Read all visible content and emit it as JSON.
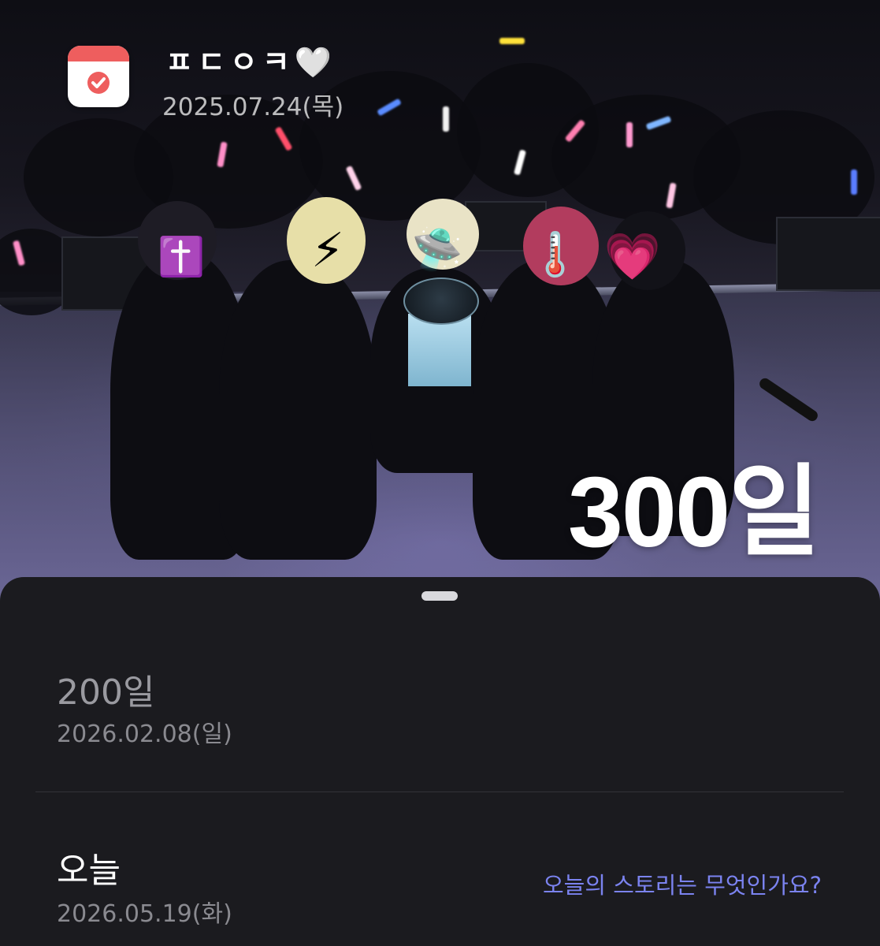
{
  "header": {
    "title": "ㅍㄷㅇㅋ🤍",
    "date": "2025.07.24(목)",
    "icon": "calendar-check-icon"
  },
  "hero": {
    "days_label": "300일",
    "photo": "concert-group-photo"
  },
  "sheet": {
    "milestones": [
      {
        "label": "200일",
        "date": "2026.02.08(일)"
      },
      {
        "label": "오늘",
        "date": "2026.05.19(화)",
        "action": "오늘의 스토리는 무엇인가요?"
      }
    ]
  },
  "colors": {
    "accent_link": "#7b83f0",
    "icon_band": "#ee5e5e",
    "sheet_bg": "#1b1b1f"
  },
  "emoji_covers": [
    "✝️",
    "⚡",
    "🛸",
    "🌡️",
    "💗"
  ]
}
